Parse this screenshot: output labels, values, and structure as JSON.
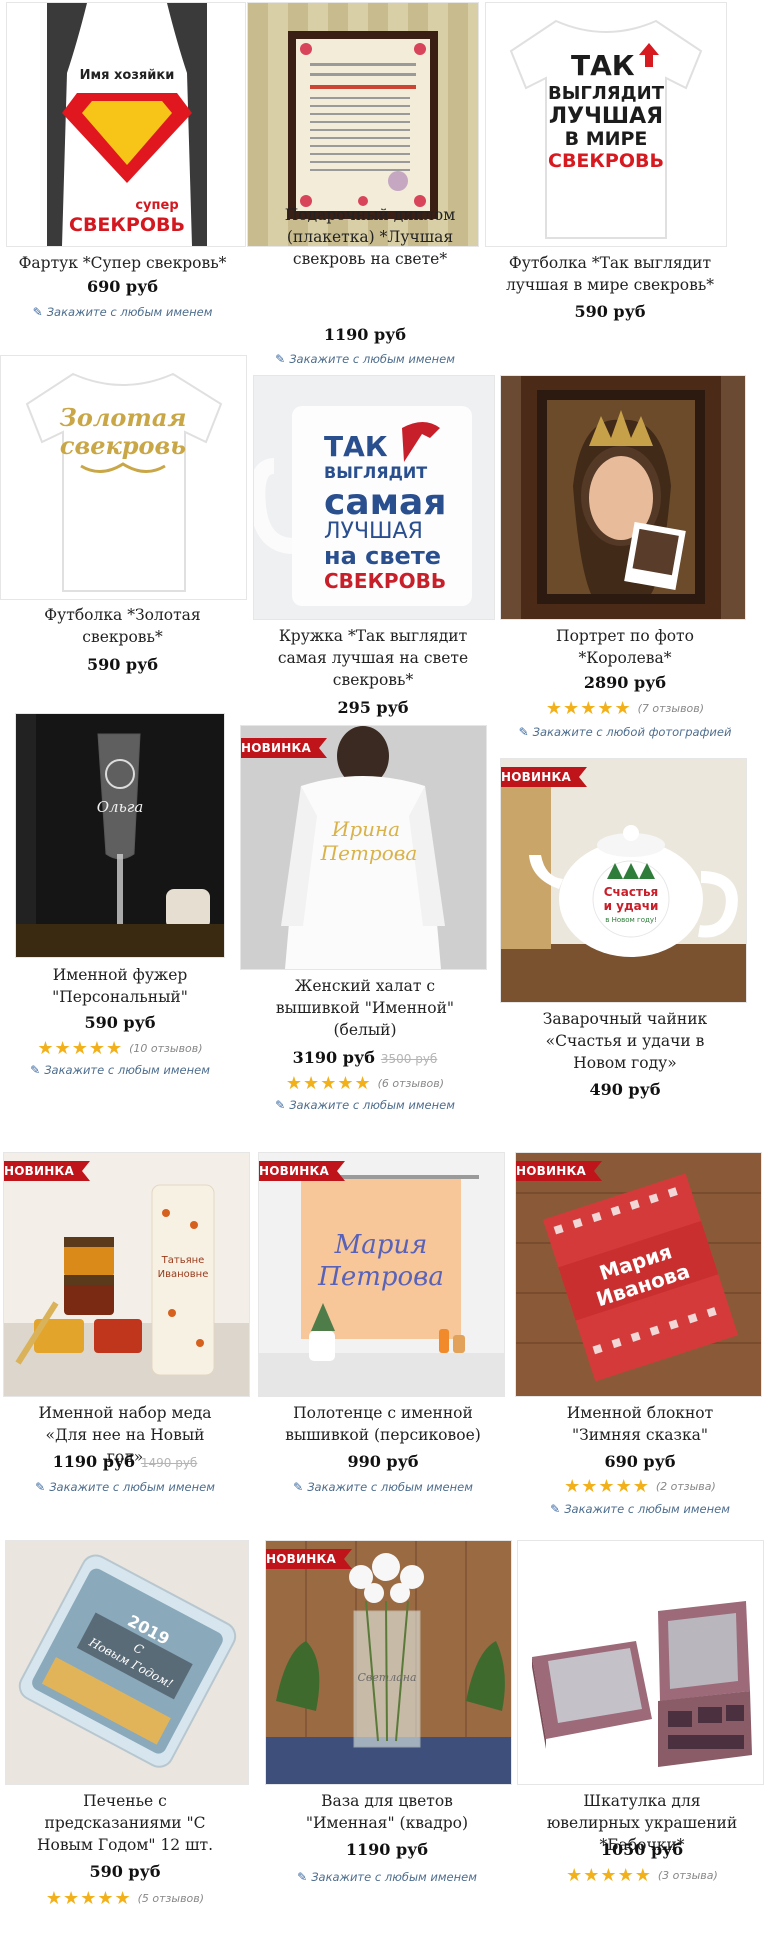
{
  "labels": {
    "new_badge": "НОВИНКА",
    "pen_icon": "pencil-icon",
    "star_icon": "star-icon"
  },
  "products": [
    {
      "title": "Фартук *Супер свекровь*",
      "price": "690 руб",
      "custom": "Закажите с любым именем"
    },
    {
      "title": "Подарочный диплом (плакетка) *Лучшая свекровь на свете*",
      "price": "1190 руб",
      "custom": "Закажите с любым именем"
    },
    {
      "title": "Футболка *Так выглядит лучшая в мире свекровь*",
      "price": "590 руб"
    },
    {
      "title": "Футболка *Золотая свекровь*",
      "price": "590 руб"
    },
    {
      "title": "Кружка *Так выглядит самая лучшая на свете свекровь*",
      "price": "295 руб"
    },
    {
      "title": "Портрет по фото *Королева*",
      "price": "2890 руб",
      "stars": "★★★★★",
      "reviews": "(7 отзывов)",
      "custom": "Закажите с любой фотографией"
    },
    {
      "title": "Именной фужер \"Персональный\"",
      "price": "590 руб",
      "stars": "★★★★★",
      "reviews": "(10 отзывов)",
      "custom": "Закажите с любым именем"
    },
    {
      "title": "Женский халат с вышивкой \"Именной\" (белый)",
      "price": "3190 руб",
      "old_price": "3500 руб",
      "stars": "★★★★★",
      "reviews": "(6 отзывов)",
      "custom": "Закажите с любым именем"
    },
    {
      "title": "Заварочный чайник «Счастья и удачи в Новом году»",
      "price": "490 руб"
    },
    {
      "title": "Именной набор меда «Для нее на Новый год»",
      "price": "1190 руб",
      "old_price": "1490 руб",
      "custom": "Закажите с любым именем"
    },
    {
      "title": "Полотенце с именной вышивкой (персиковое)",
      "price": "990 руб",
      "custom": "Закажите с любым именем"
    },
    {
      "title": "Именной блокнот \"Зимняя сказка\"",
      "price": "690 руб",
      "stars": "★★★★★",
      "reviews": "(2 отзыва)",
      "custom": "Закажите с любым именем"
    },
    {
      "title": "Печенье с предсказаниями \"С Новым Годом\" 12 шт.",
      "price": "590 руб",
      "stars": "★★★★★",
      "reviews": "(5 отзывов)"
    },
    {
      "title": "Ваза для цветов \"Именная\" (квадро)",
      "price": "1190 руб",
      "custom": "Закажите с любым именем"
    },
    {
      "title": "Шкатулка для ювелирных украшений *Бабочки*",
      "price": "1050 руб",
      "stars": "★★★★★",
      "reviews": "(3 отзыва)"
    }
  ],
  "image_texts": {
    "apron_top": "Имя хозяйки",
    "apron_mid": "супер",
    "apron_bottom": "СВЕКРОВЬ",
    "tshirt1_l1": "ТАК",
    "tshirt1_l2": "ВЫГЛЯДИТ",
    "tshirt1_l3": "ЛУЧШАЯ",
    "tshirt1_l4": "В МИРЕ",
    "tshirt1_l5": "СВЕКРОВЬ",
    "tshirt2_l1": "Золотая",
    "tshirt2_l2": "свекровь",
    "mug_l1": "ТАК",
    "mug_l2": "ВЫГЛЯДИТ",
    "mug_l3": "самая",
    "mug_l4": "ЛУЧШАЯ",
    "mug_l5": "на свете",
    "mug_l6": "СВЕКРОВЬ",
    "glass_name": "Ольга",
    "robe_l1": "Ирина",
    "robe_l2": "Петрова",
    "teapot_l1": "Счастья",
    "teapot_l2": "и удачи",
    "teapot_l3": "в Новом году!",
    "honey_l1": "Татьяне",
    "honey_l2": "Ивановне",
    "towel_l1": "Мария",
    "towel_l2": "Петрова",
    "notebook_l1": "Мария",
    "notebook_l2": "Иванова",
    "cookie_year": "2019",
    "cookie_l1": "С",
    "cookie_l2": "Новым Годом!",
    "vase_name": "Светлана"
  },
  "colors": {
    "accent_red": "#c0141b",
    "star_gold": "#f2b11b",
    "link_blue": "#4e6e8e"
  }
}
